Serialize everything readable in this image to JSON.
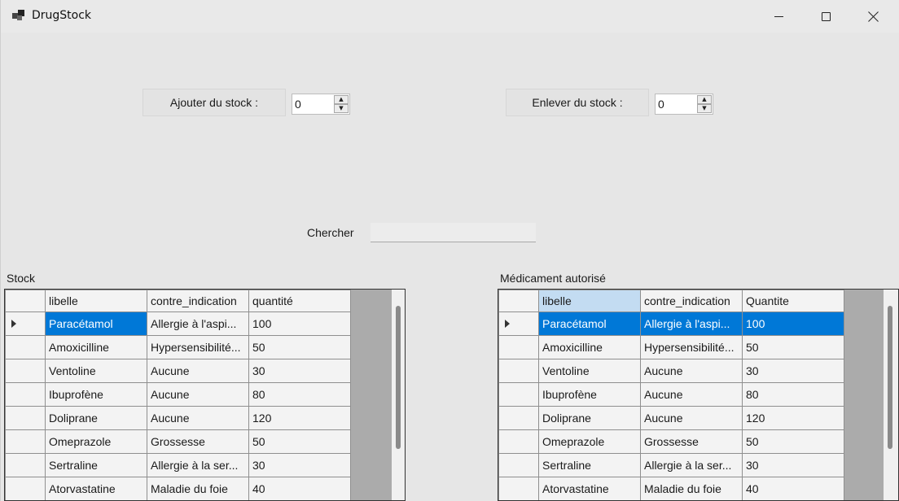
{
  "window": {
    "title": "DrugStock",
    "minimize_icon": "minimize-icon",
    "maximize_icon": "maximize-icon",
    "close_icon": "close-icon"
  },
  "controls": {
    "add_label": "Ajouter du stock :",
    "add_value": "0",
    "remove_label": "Enlever du stock :",
    "remove_value": "0",
    "search_label": "Chercher",
    "search_value": ""
  },
  "stock_grid": {
    "caption": "Stock",
    "columns": [
      "libelle",
      "contre_indication",
      "quantité"
    ],
    "selected_row": 0,
    "rows": [
      [
        "Paracétamol",
        "Allergie à l'aspi...",
        "100"
      ],
      [
        "Amoxicilline",
        "Hypersensibilité...",
        "50"
      ],
      [
        "Ventoline",
        "Aucune",
        "30"
      ],
      [
        "Ibuprofène",
        "Aucune",
        "80"
      ],
      [
        "Doliprane",
        "Aucune",
        "120"
      ],
      [
        "Omeprazole",
        "Grossesse",
        "50"
      ],
      [
        "Sertraline",
        "Allergie à la ser...",
        "30"
      ],
      [
        "Atorvastatine",
        "Maladie du foie",
        "40"
      ]
    ]
  },
  "authorized_grid": {
    "caption": "Médicament autorisé",
    "columns": [
      "libelle",
      "contre_indication",
      "Quantite"
    ],
    "selected_row": 0,
    "rows": [
      [
        "Paracétamol",
        "Allergie à l'aspi...",
        "100"
      ],
      [
        "Amoxicilline",
        "Hypersensibilité...",
        "50"
      ],
      [
        "Ventoline",
        "Aucune",
        "30"
      ],
      [
        "Ibuprofène",
        "Aucune",
        "80"
      ],
      [
        "Doliprane",
        "Aucune",
        "120"
      ],
      [
        "Omeprazole",
        "Grossesse",
        "50"
      ],
      [
        "Sertraline",
        "Allergie à la ser...",
        "30"
      ],
      [
        "Atorvastatine",
        "Maladie du foie",
        "40"
      ]
    ]
  },
  "colors": {
    "selection": "#0078d7",
    "header_selected": "#c3dcf2",
    "grid_background": "#ababab"
  }
}
